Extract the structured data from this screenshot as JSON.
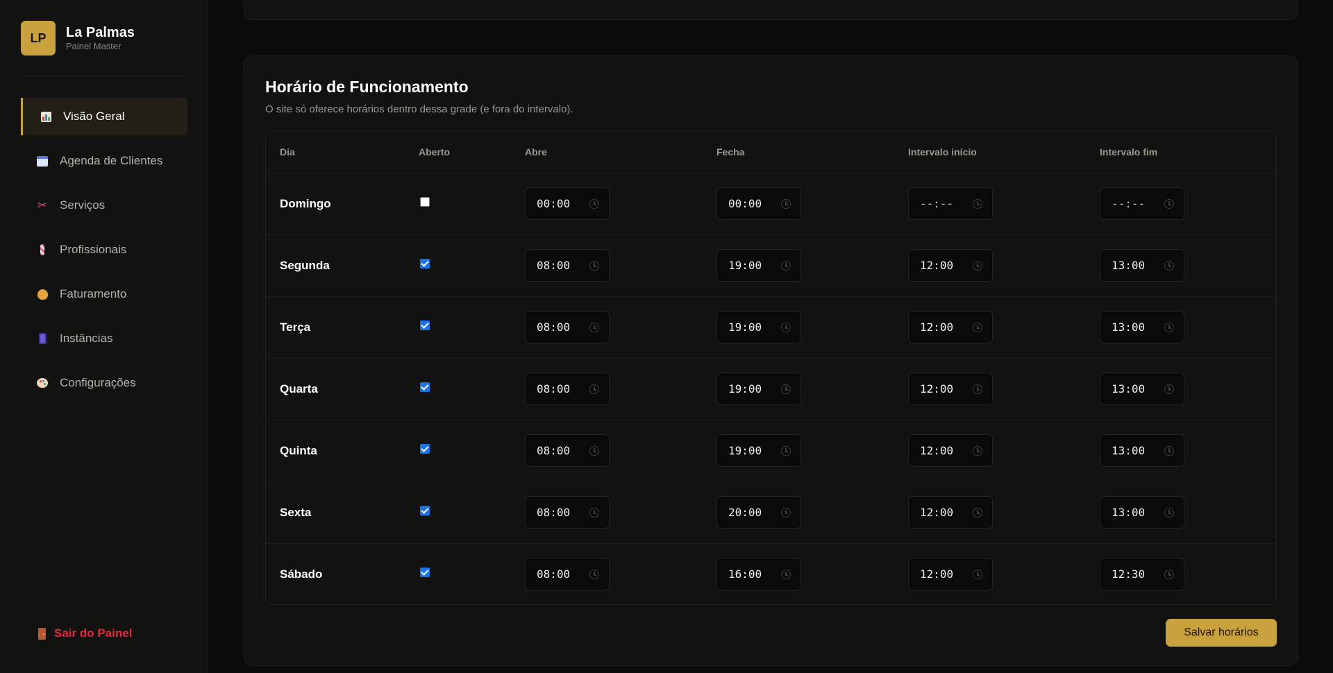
{
  "brand": {
    "logo": "LP",
    "name": "La Palmas",
    "subtitle": "Painel Master"
  },
  "nav": [
    {
      "label": "Visão Geral",
      "icon": "chart-icon",
      "active": true
    },
    {
      "label": "Agenda de Clientes",
      "icon": "calendar-icon",
      "active": false
    },
    {
      "label": "Serviços",
      "icon": "scissors-icon",
      "active": false
    },
    {
      "label": "Profissionais",
      "icon": "barber-pole-icon",
      "active": false
    },
    {
      "label": "Faturamento",
      "icon": "money-bag-icon",
      "active": false
    },
    {
      "label": "Instâncias",
      "icon": "phone-icon",
      "active": false
    },
    {
      "label": "Configurações",
      "icon": "palette-icon",
      "active": false
    }
  ],
  "logout": {
    "label": "Sair do Painel",
    "icon": "door-icon"
  },
  "schedule": {
    "title": "Horário de Funcionamento",
    "subtitle": "O site só oferece horários dentro dessa grade (e fora do intervalo).",
    "columns": [
      "Dia",
      "Aberto",
      "Abre",
      "Fecha",
      "Intervalo início",
      "Intervalo fim"
    ],
    "rows": [
      {
        "day": "Domingo",
        "open": false,
        "opens": "00:00",
        "closes": "00:00",
        "break_start": "--:--",
        "break_end": "--:--"
      },
      {
        "day": "Segunda",
        "open": true,
        "opens": "08:00",
        "closes": "19:00",
        "break_start": "12:00",
        "break_end": "13:00"
      },
      {
        "day": "Terça",
        "open": true,
        "opens": "08:00",
        "closes": "19:00",
        "break_start": "12:00",
        "break_end": "13:00"
      },
      {
        "day": "Quarta",
        "open": true,
        "opens": "08:00",
        "closes": "19:00",
        "break_start": "12:00",
        "break_end": "13:00"
      },
      {
        "day": "Quinta",
        "open": true,
        "opens": "08:00",
        "closes": "19:00",
        "break_start": "12:00",
        "break_end": "13:00"
      },
      {
        "day": "Sexta",
        "open": true,
        "opens": "08:00",
        "closes": "20:00",
        "break_start": "12:00",
        "break_end": "13:00"
      },
      {
        "day": "Sábado",
        "open": true,
        "opens": "08:00",
        "closes": "16:00",
        "break_start": "12:00",
        "break_end": "12:30"
      }
    ],
    "save_label": "Salvar horários"
  },
  "colors": {
    "accent": "#c9a23e",
    "danger": "#e5283c",
    "checkbox": "#1a73e8"
  }
}
